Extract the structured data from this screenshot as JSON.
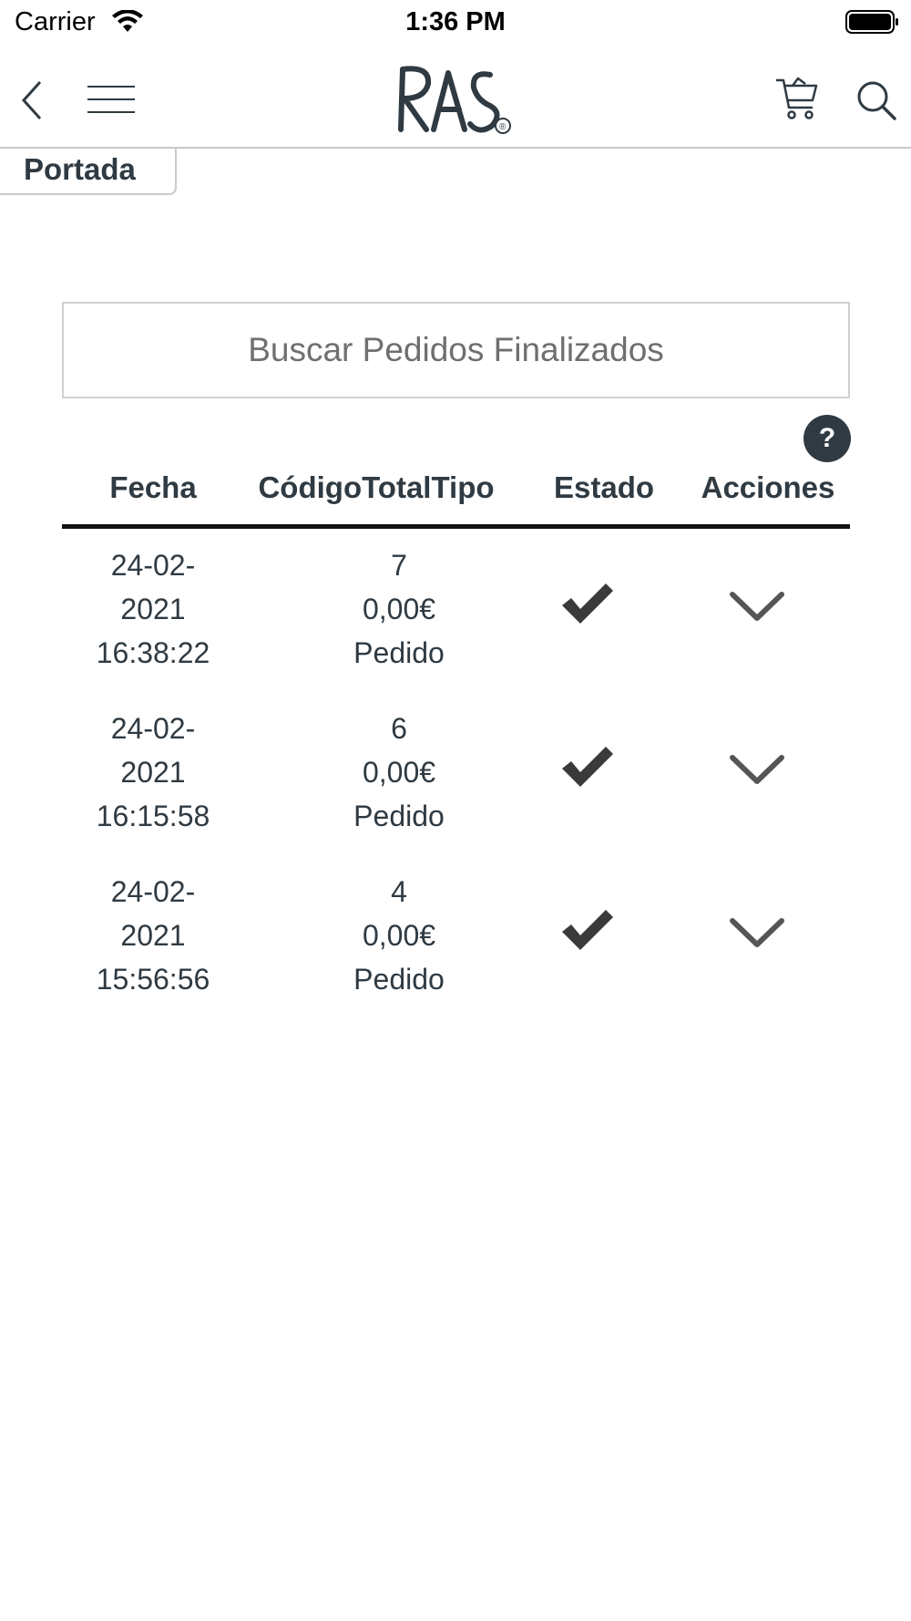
{
  "status_bar": {
    "carrier": "Carrier",
    "time": "1:36 PM"
  },
  "nav": {
    "logo_text": "RAS",
    "logo_mark": "®"
  },
  "breadcrumb": {
    "label": "Portada"
  },
  "search": {
    "placeholder": "Buscar Pedidos Finalizados"
  },
  "help": {
    "label": "?"
  },
  "table": {
    "headers": {
      "fecha": "Fecha",
      "codigo_total_tipo": "CódigoTotalTipo",
      "estado": "Estado",
      "acciones": "Acciones"
    },
    "rows": [
      {
        "date": "24-02-",
        "year": "2021",
        "time": "16:38:22",
        "code": "7",
        "total": "0,00€",
        "type": "Pedido",
        "status_icon": "check-icon",
        "action_icon": "chevron-down-icon"
      },
      {
        "date": "24-02-",
        "year": "2021",
        "time": "16:15:58",
        "code": "6",
        "total": "0,00€",
        "type": "Pedido",
        "status_icon": "check-icon",
        "action_icon": "chevron-down-icon"
      },
      {
        "date": "24-02-",
        "year": "2021",
        "time": "15:56:56",
        "code": "4",
        "total": "0,00€",
        "type": "Pedido",
        "status_icon": "check-icon",
        "action_icon": "chevron-down-icon"
      }
    ]
  },
  "colors": {
    "text": "#2f3a42",
    "border": "#c9c9c9",
    "header_rule": "#111111",
    "icon": "#3a3a3a"
  }
}
